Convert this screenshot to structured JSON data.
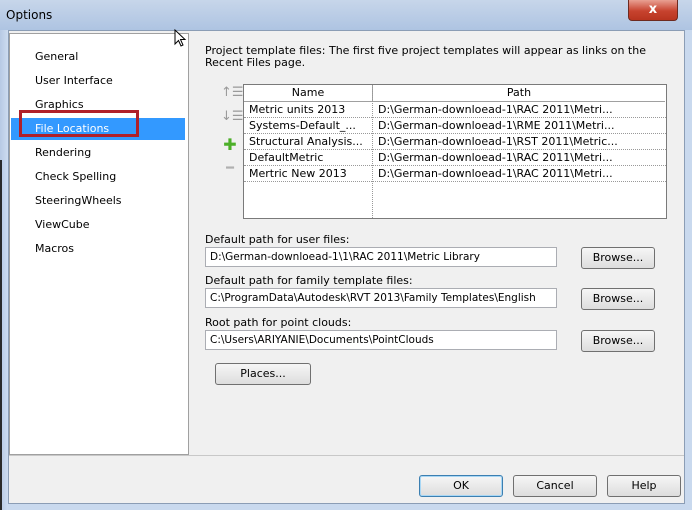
{
  "window": {
    "title": "Options",
    "close_glyph": "x"
  },
  "sidebar": {
    "items": [
      {
        "label": "General"
      },
      {
        "label": "User Interface"
      },
      {
        "label": "Graphics"
      },
      {
        "label": "File Locations",
        "selected": true
      },
      {
        "label": "Rendering"
      },
      {
        "label": "Check Spelling"
      },
      {
        "label": "SteeringWheels"
      },
      {
        "label": "ViewCube"
      },
      {
        "label": "Macros"
      }
    ]
  },
  "templates": {
    "description": "Project template files:  The first five project templates will appear as links on the Recent Files page.",
    "columns": {
      "name": "Name",
      "path": "Path"
    },
    "rows": [
      {
        "name": "Metric units 2013",
        "path": "D:\\German-downloead-1\\RAC 2011\\Metri..."
      },
      {
        "name": "Systems-Default_...",
        "path": "D:\\German-downloead-1\\RME 2011\\Metri..."
      },
      {
        "name": "Structural Analysis...",
        "path": "D:\\German-downloead-1\\RST 2011\\Metric..."
      },
      {
        "name": "DefaultMetric",
        "path": "D:\\German-downloead-1\\RAC 2011\\Metri..."
      },
      {
        "name": "Mertric New 2013",
        "path": "D:\\German-downloead-1\\RAC 2011\\Metri..."
      }
    ],
    "tools": {
      "move_up_glyph": "↑☰",
      "move_down_glyph": "↓☰",
      "add_glyph": "✚",
      "remove_glyph": "━"
    }
  },
  "user_files": {
    "label": "Default path for user files:",
    "value": "D:\\German-downloead-1\\1\\RAC 2011\\Metric Library",
    "browse_label": "Browse..."
  },
  "family_templates": {
    "label": "Default path for family template files:",
    "value": "C:\\ProgramData\\Autodesk\\RVT 2013\\Family Templates\\English",
    "browse_label": "Browse..."
  },
  "point_clouds": {
    "label": "Root path for point clouds:",
    "value": "C:\\Users\\ARIYANIE\\Documents\\PointClouds",
    "browse_label": "Browse..."
  },
  "places_label": "Places...",
  "footer": {
    "ok_label": "OK",
    "cancel_label": "Cancel",
    "help_label": "Help"
  },
  "colors": {
    "selection": "#3399ff",
    "highlight_border": "#b0202a",
    "add_icon": "#4caf28"
  }
}
